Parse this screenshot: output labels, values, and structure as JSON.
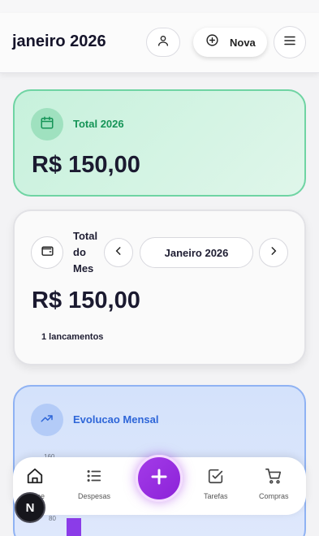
{
  "header": {
    "title": "janeiro 2026",
    "new_label": "Nova",
    "icons": [
      "user-icon",
      "plus-circle-icon",
      "menu-icon"
    ]
  },
  "total_year": {
    "label": "Total 2026",
    "amount": "R$ 150,00",
    "icon": "calendar-icon",
    "accent": "#159457"
  },
  "month_card": {
    "label": "Total do Mes",
    "selector": "Janeiro 2026",
    "amount": "R$ 150,00",
    "count_text": "1 lancamentos",
    "icon": "wallet-icon"
  },
  "evolution": {
    "label": "Evolucao Mensal",
    "icon": "trending-up-icon",
    "accent": "#2e66d8",
    "y_ticks_visible": [
      "160",
      "80"
    ],
    "bar_color": "#8b3ce8"
  },
  "bottom_nav": {
    "items": [
      {
        "label": "Home",
        "icon": "home-icon"
      },
      {
        "label": "Despesas",
        "icon": "list-icon"
      },
      {
        "label": "Tarefas",
        "icon": "checkbox-icon"
      },
      {
        "label": "Compras",
        "icon": "cart-icon"
      }
    ],
    "fab_icon": "plus-icon",
    "fab_color": "#9b2fe2"
  },
  "overlay_badge": "N"
}
